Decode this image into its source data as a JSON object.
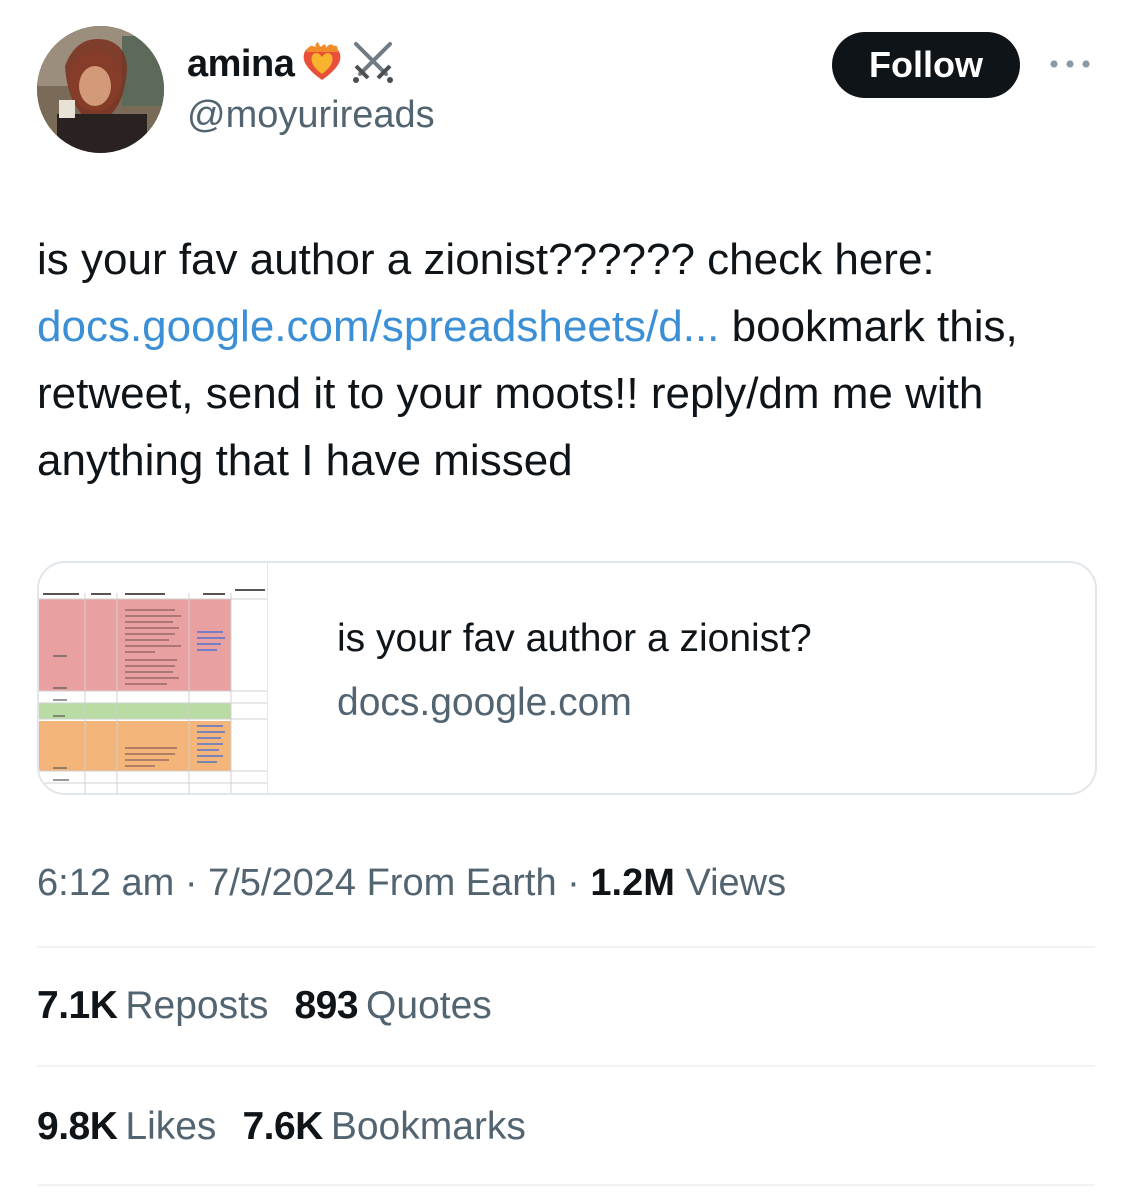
{
  "user": {
    "display_name": "amina",
    "name_emojis": [
      "burning-heart-emoji",
      "crossed-swords-emoji"
    ],
    "handle": "@moyurireads"
  },
  "follow_label": "Follow",
  "tweet": {
    "text_before_link": "is your fav author a zionist?????? check here: ",
    "link_text": "docs.google.com/spreadsheets/d...",
    "text_after_link": " bookmark this, retweet, send it to your moots!! reply/dm me with anything that I have missed"
  },
  "card": {
    "title": "is your fav author a zionist?",
    "domain": "docs.google.com"
  },
  "meta": {
    "time": "6:12 am",
    "sep1": " · ",
    "date": "7/5/2024",
    "source": " From Earth",
    "sep2": " · ",
    "views_count": "1.2M",
    "views_label": " Views"
  },
  "stats": {
    "reposts": {
      "count": "7.1K",
      "label": "Reposts"
    },
    "quotes": {
      "count": "893",
      "label": "Quotes"
    },
    "likes": {
      "count": "9.8K",
      "label": "Likes"
    },
    "bookmarks": {
      "count": "7.6K",
      "label": "Bookmarks"
    }
  },
  "colors": {
    "link": "#3b8fd6",
    "text": "#0f1419",
    "secondary": "#536471",
    "divider": "#eff3f4"
  }
}
